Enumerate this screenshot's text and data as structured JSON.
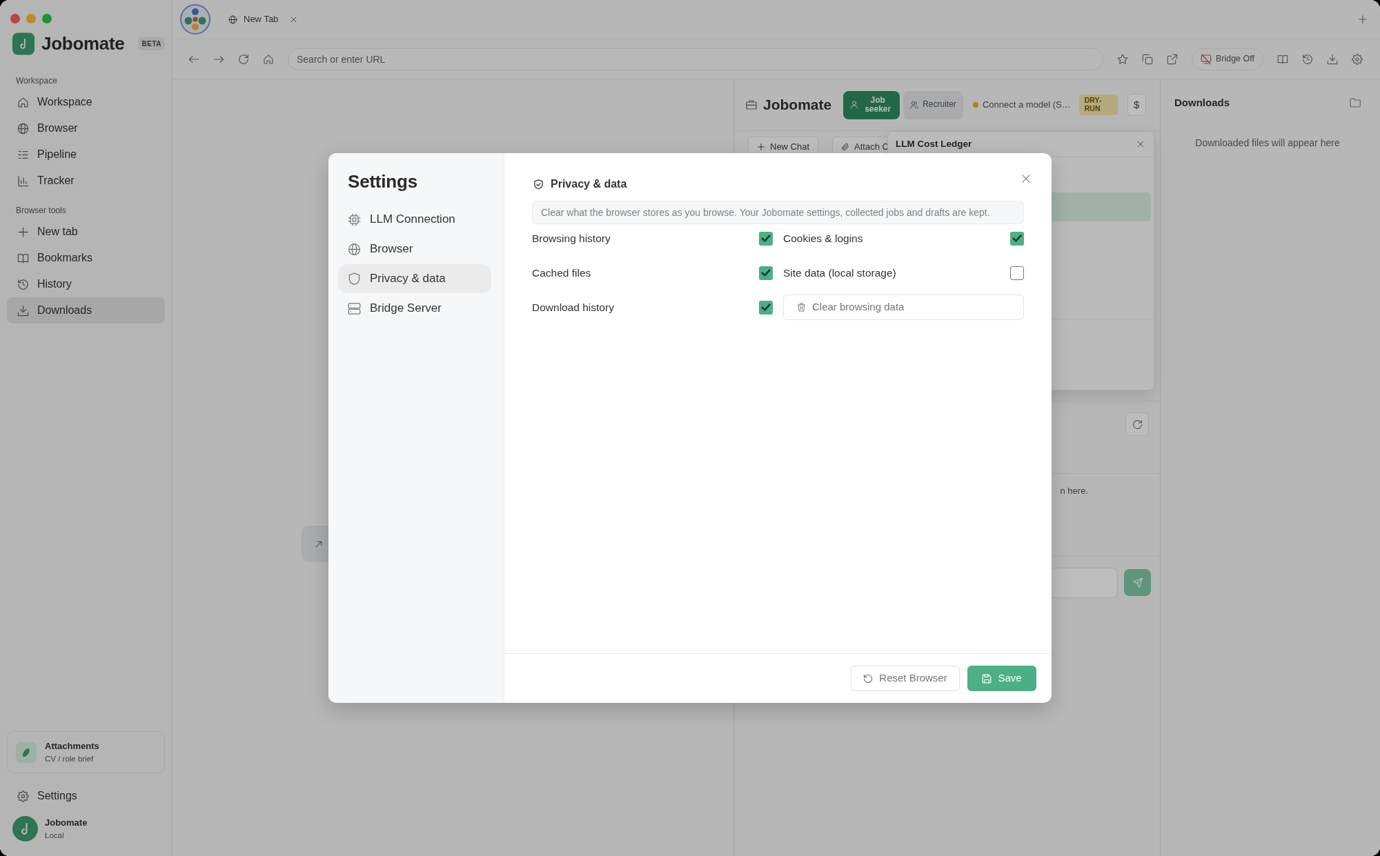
{
  "sidebar": {
    "app_name": "Jobomate",
    "badge": "BETA",
    "sections": [
      {
        "title": "Workspace",
        "items": [
          {
            "label": "Workspace",
            "selected": false
          },
          {
            "label": "Browser",
            "selected": false
          },
          {
            "label": "Pipeline",
            "selected": false
          },
          {
            "label": "Tracker",
            "selected": false
          }
        ]
      },
      {
        "title": "Browser tools",
        "items": [
          {
            "label": "New tab",
            "selected": false
          },
          {
            "label": "Bookmarks",
            "selected": false
          },
          {
            "label": "History",
            "selected": false
          },
          {
            "label": "Downloads",
            "selected": true
          }
        ]
      }
    ],
    "attachments": {
      "title": "Attachments",
      "subtitle": "CV / role brief"
    },
    "settings": "Settings",
    "profile": {
      "name": "Jobomate",
      "subtitle": "Local"
    }
  },
  "browser": {
    "tabs": [
      {
        "label": "New Tab",
        "selected": true
      }
    ],
    "url_bar": {
      "placeholder": "Search or enter URL"
    },
    "bridge_button": "Bridge Off"
  },
  "chat_panel": {
    "title": "Jobomate",
    "modes": [
      {
        "label": "Job seeker",
        "selected": true
      },
      {
        "label": "Recruiter",
        "selected": false
      }
    ],
    "model_status": "Connect a model (S…",
    "mode_badge": "DRY-RUN",
    "cost_button": "$",
    "actions": [
      "New Chat",
      "Attach C"
    ],
    "ledger": {
      "title": "LLM Cost Ledger"
    },
    "hint": "n here."
  },
  "downloads_panel": {
    "title": "Downloads",
    "empty_text": "Downloaded files will appear here"
  },
  "settings_dialog": {
    "title": "Settings",
    "nav": [
      {
        "label": "LLM Connection",
        "selected": false
      },
      {
        "label": "Browser",
        "selected": false
      },
      {
        "label": "Privacy & data",
        "selected": true
      },
      {
        "label": "Bridge Server",
        "selected": false
      }
    ],
    "section_title": "Privacy & data",
    "notice": "Clear what the browser stores as you browse. Your Jobomate settings, collected jobs and drafts are kept.",
    "options": [
      {
        "label": "Browsing history",
        "checked": true
      },
      {
        "label": "Cookies & logins",
        "checked": true
      },
      {
        "label": "Cached files",
        "checked": true
      },
      {
        "label": "Site data (local storage)",
        "checked": false
      },
      {
        "label": "Download history",
        "checked": true
      }
    ],
    "clear_button": "Clear browsing data",
    "buttons": [
      {
        "label": "Reset Browser",
        "kind": "secondary"
      },
      {
        "label": "Save",
        "kind": "primary"
      }
    ]
  }
}
